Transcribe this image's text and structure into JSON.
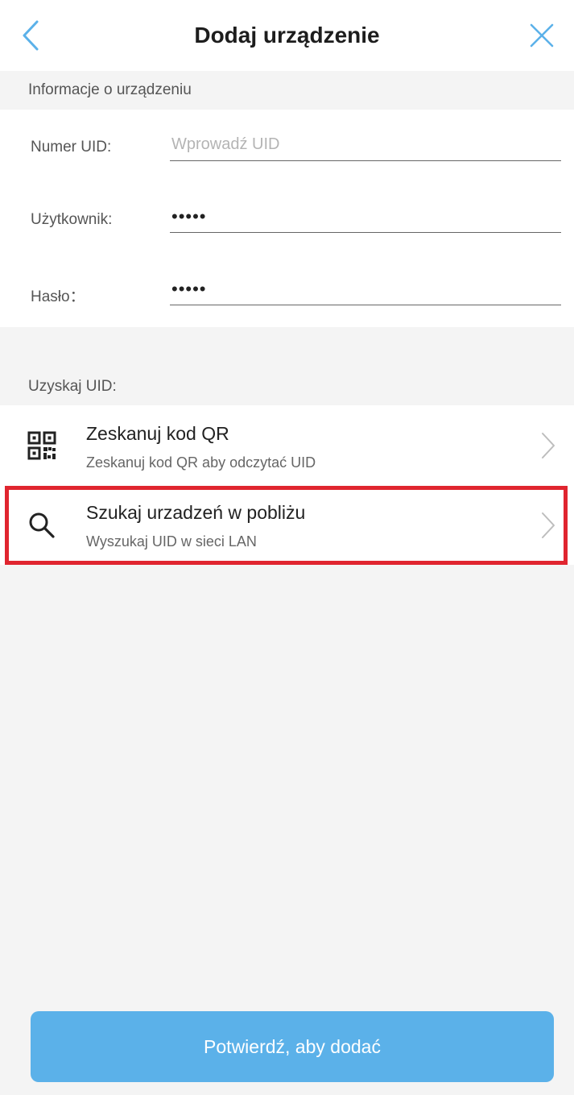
{
  "header": {
    "title": "Dodaj urządzenie",
    "back_icon": "chevron-left-icon",
    "close_icon": "close-icon",
    "accent_color": "#5bb1e9"
  },
  "device_info": {
    "section_label": "Informacje o urządzeniu",
    "fields": [
      {
        "label": "Numer UID:",
        "value": "",
        "placeholder": "Wprowadź UID"
      },
      {
        "label": "Użytkownik:",
        "value": "•••••",
        "placeholder": ""
      },
      {
        "label": "Hasło：",
        "value": "•••••",
        "placeholder": ""
      }
    ]
  },
  "get_uid": {
    "section_label": "Uzyskaj UID:",
    "options": [
      {
        "title": "Zeskanuj kod QR",
        "subtitle": "Zeskanuj kod QR aby odczytać UID",
        "icon": "qr-code-icon"
      },
      {
        "title": "Szukaj urzadzeń w pobliżu",
        "subtitle": "Wyszukaj UID w sieci LAN",
        "icon": "search-icon",
        "highlight_color": "#e0252f"
      }
    ]
  },
  "confirm_button": {
    "label": "Potwierdź, aby dodać"
  }
}
